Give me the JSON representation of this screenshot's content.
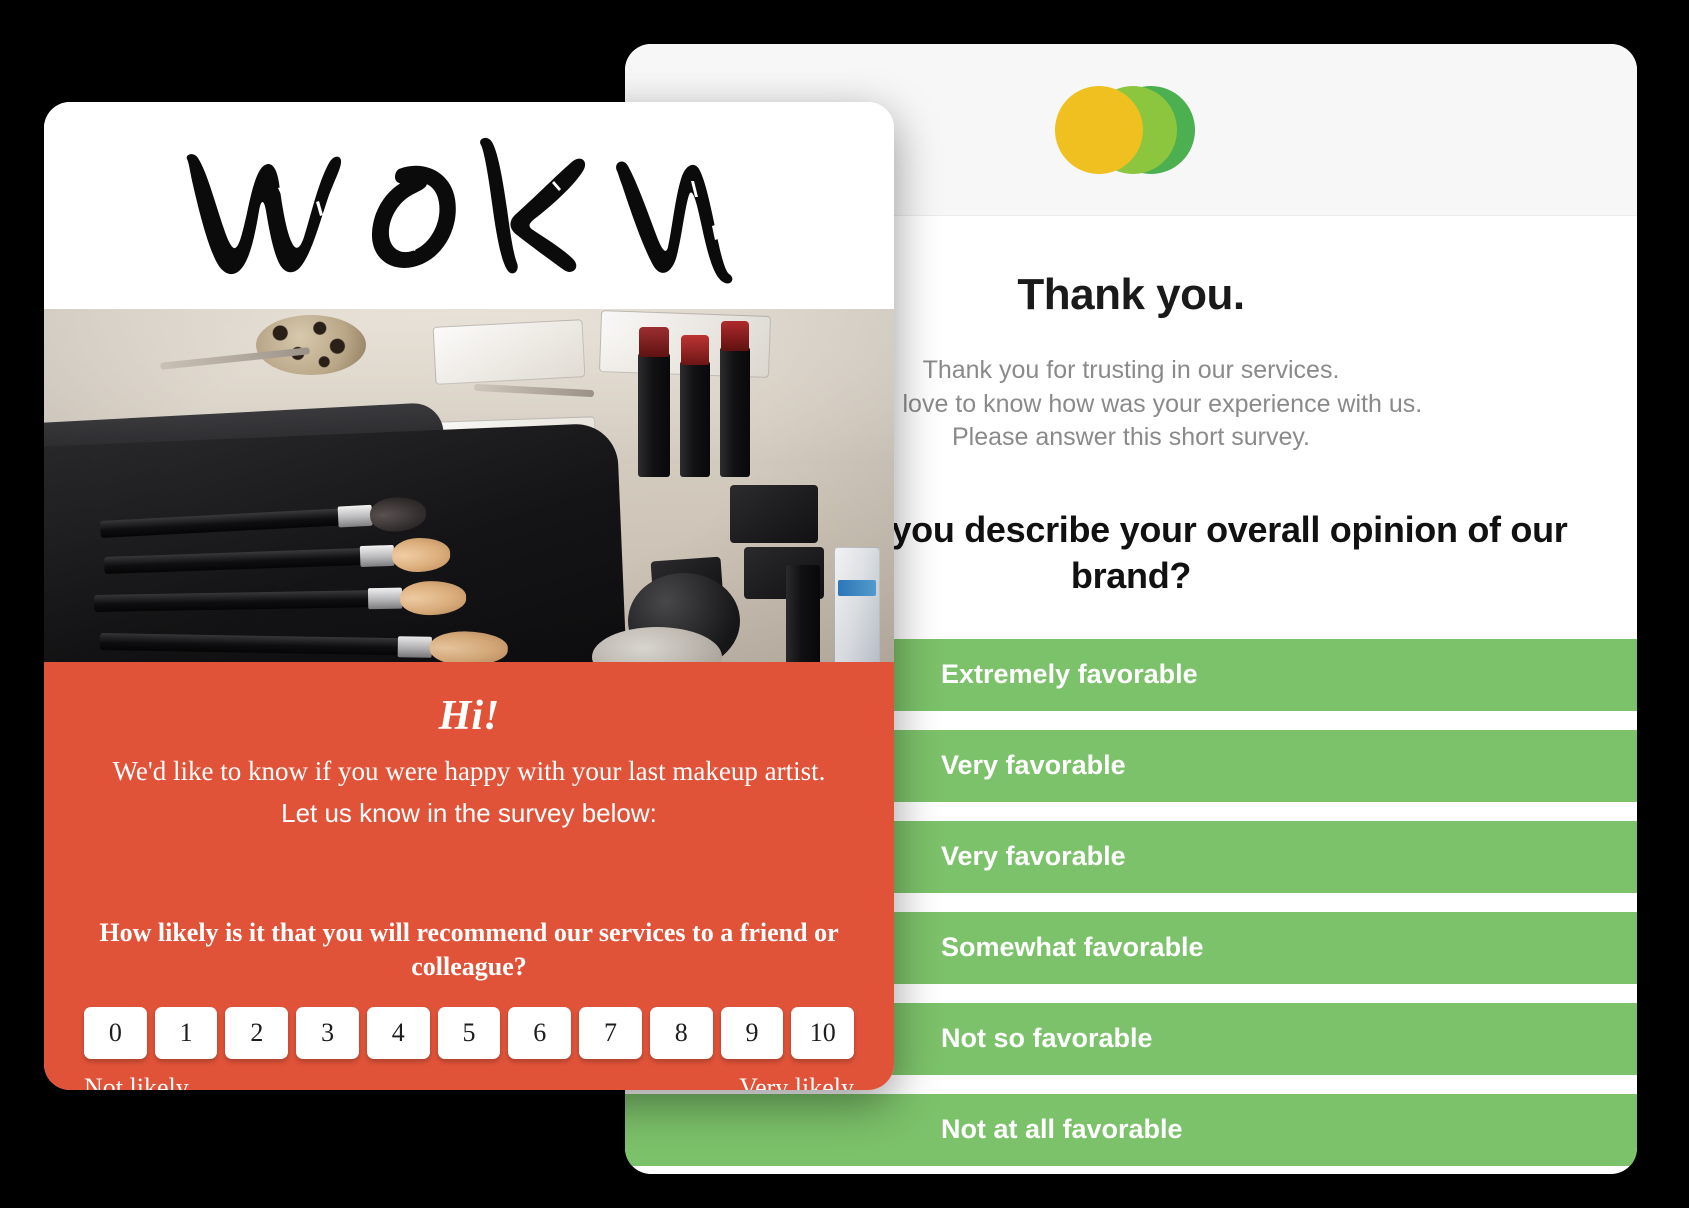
{
  "survey_card": {
    "logo": {
      "name": "overlapping-circles-logo",
      "colors": [
        "#EFC01F",
        "#8CC63F",
        "#4CAF50"
      ]
    },
    "title": "Thank you.",
    "intro_lines": [
      "Thank you for trusting in our services.",
      "We'd love to know how was your experience with us.",
      "Please answer this short survey."
    ],
    "question": "How would you describe your overall opinion of our brand?",
    "options": [
      {
        "label": "Extremely favorable"
      },
      {
        "label": "Very favorable"
      },
      {
        "label": "Very favorable"
      },
      {
        "label": "Somewhat favorable"
      },
      {
        "label": "Not so favorable"
      },
      {
        "label": "Not at all favorable"
      }
    ],
    "option_color": "#7CC26A",
    "header_bg": "#F7F7F7"
  },
  "email_card": {
    "brand_wordmark": "WORN",
    "hero_image_alt": "makeup-brushes-and-lipsticks-flatlay",
    "panel_color": "#E05339",
    "greeting": "Hi!",
    "intro_serif": "We'd like to know if you were happy with your last makeup artist.",
    "intro_sans": "Let us know in the survey below:",
    "nps_question": "How likely is it that you will recommend our services to a friend or colleague?",
    "nps_values": [
      "0",
      "1",
      "2",
      "3",
      "4",
      "5",
      "6",
      "7",
      "8",
      "9",
      "10"
    ],
    "anchor_low": "Not likely",
    "anchor_high": "Very likely"
  }
}
